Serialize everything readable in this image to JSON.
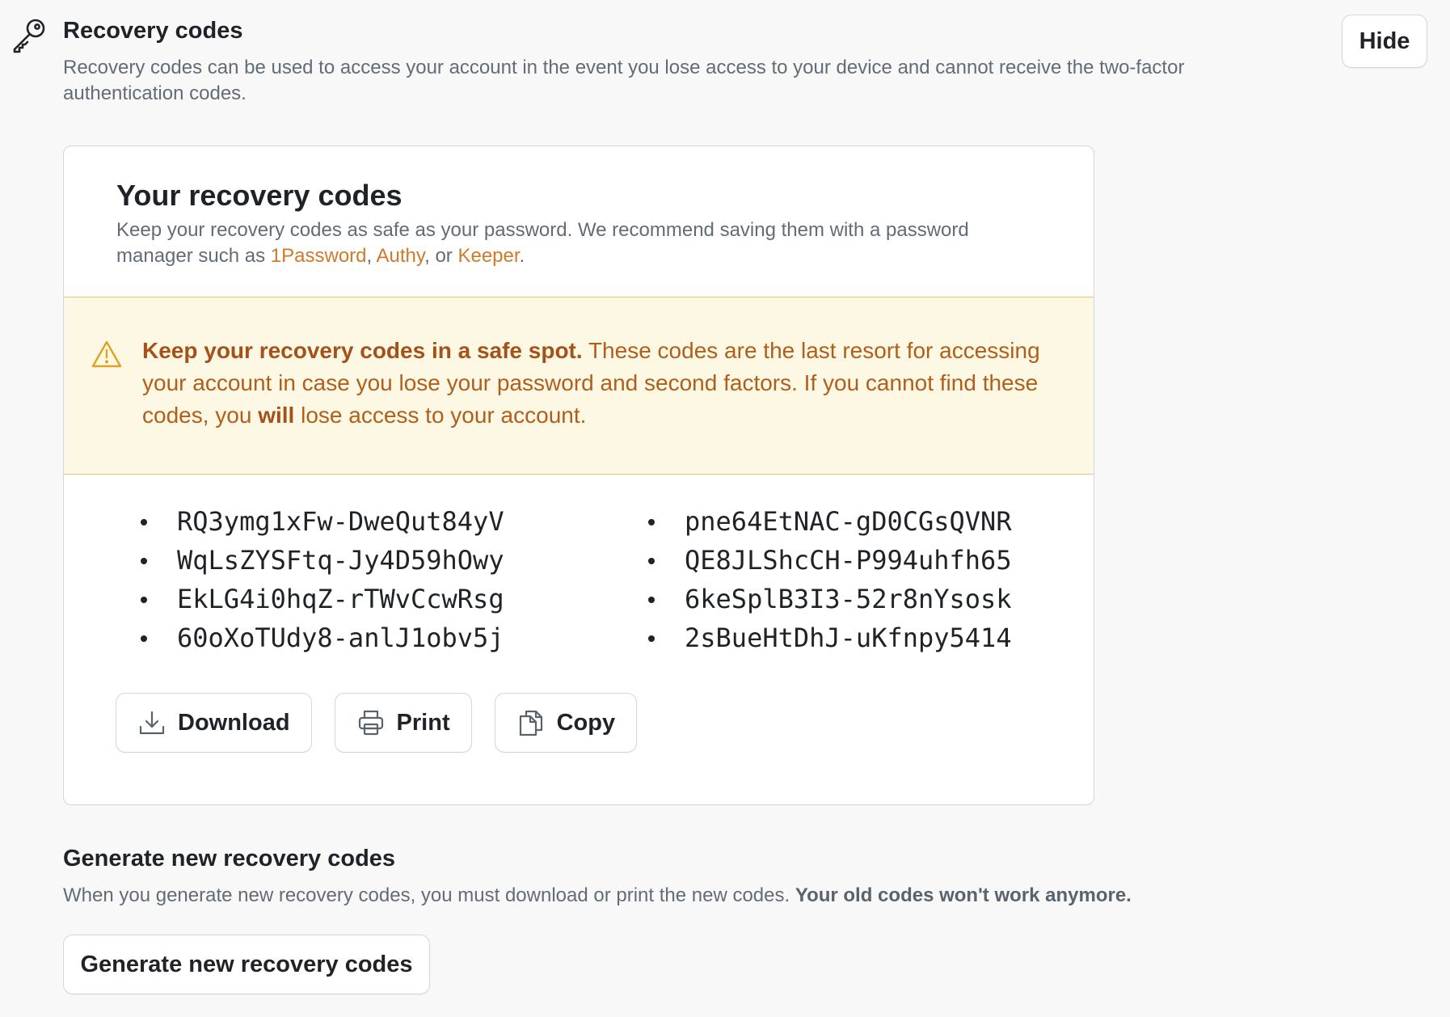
{
  "header": {
    "icon": "key-icon",
    "title": "Recovery codes",
    "description": "Recovery codes can be used to access your account in the event you lose access to your device and cannot receive the two-factor authentication codes.",
    "hide_label": "Hide"
  },
  "card": {
    "title": "Your recovery codes",
    "desc_prefix": "Keep your recovery codes as safe as your password. We recommend saving them with a password manager such as ",
    "links": [
      "1Password",
      "Authy",
      "Keeper"
    ],
    "sep_1": ", ",
    "sep_2": ", or ",
    "desc_suffix": ".",
    "warning": {
      "icon": "alert-triangle-icon",
      "bold": "Keep your recovery codes in a safe spot.",
      "text_1": " These codes are the last resort for accessing your account in case you lose your password and second factors. If you cannot find these codes, you ",
      "bold_2": "will",
      "text_2": " lose access to your account."
    },
    "codes_left": [
      "RQ3ymg1xFw-DweQut84yV",
      "WqLsZYSFtq-Jy4D59hOwy",
      "EkLG4i0hqZ-rTWvCcwRsg",
      "60oXoTUdy8-anlJ1obv5j"
    ],
    "codes_right": [
      "pne64EtNAC-gD0CGsQVNR",
      "QE8JLShcCH-P994uhfh65",
      "6keSplB3I3-52r8nYsosk",
      "2sBueHtDhJ-uKfnpy5414"
    ],
    "actions": {
      "download": "Download",
      "print": "Print",
      "copy": "Copy"
    }
  },
  "generate": {
    "title": "Generate new recovery codes",
    "desc": "When you generate new recovery codes, you must download or print the new codes. ",
    "desc_bold": "Your old codes won't work anymore.",
    "button_label": "Generate new recovery codes"
  },
  "colors": {
    "accent_link": "#cf7a2b",
    "warning_bg": "#fdf8e4",
    "warning_border": "#ecc366",
    "warning_text": "#b25e1b"
  }
}
